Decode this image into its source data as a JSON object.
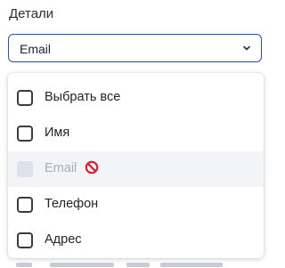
{
  "field_label": "Детали",
  "select": {
    "value": "Email",
    "icon": "chevron-down-icon"
  },
  "dropdown": {
    "options": [
      {
        "label": "Выбрать все",
        "checked": false,
        "disabled": false
      },
      {
        "label": "Имя",
        "checked": false,
        "disabled": false
      },
      {
        "label": "Email",
        "checked": false,
        "disabled": true,
        "icon": "no-entry-icon"
      },
      {
        "label": "Телефон",
        "checked": false,
        "disabled": false
      },
      {
        "label": "Адрес",
        "checked": false,
        "disabled": false
      }
    ]
  },
  "colors": {
    "accent_border": "#2e4fa6",
    "disabled_row_bg": "#f2f4f8",
    "no_entry_red": "#d8202f"
  }
}
